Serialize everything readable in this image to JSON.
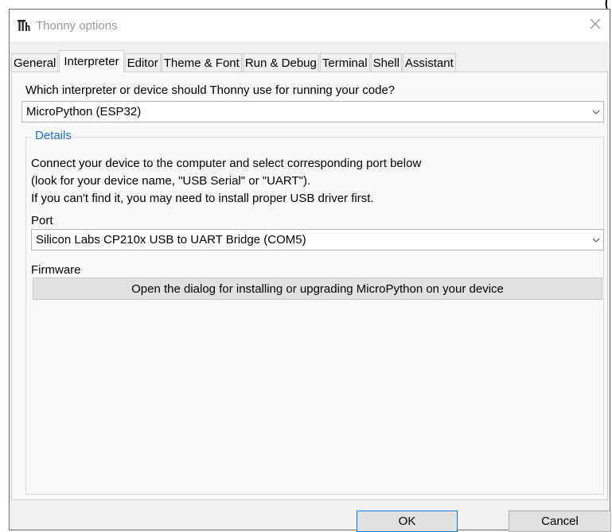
{
  "doc_fragment": "(",
  "window": {
    "title": "Thonny options",
    "close_glyph": "×"
  },
  "tabs": [
    {
      "label": "General",
      "selected": false
    },
    {
      "label": "Interpreter",
      "selected": true
    },
    {
      "label": "Editor",
      "selected": false
    },
    {
      "label": "Theme & Font",
      "selected": false
    },
    {
      "label": "Run & Debug",
      "selected": false
    },
    {
      "label": "Terminal",
      "selected": false
    },
    {
      "label": "Shell",
      "selected": false
    },
    {
      "label": "Assistant",
      "selected": false
    }
  ],
  "interpreter": {
    "question": "Which interpreter or device should Thonny use for running your code?",
    "selected": "MicroPython (ESP32)"
  },
  "details": {
    "legend": "Details",
    "lines": [
      "Connect your device to the computer and select corresponding port below",
      "(look for your device name, \"USB Serial\" or \"UART\").",
      "If you can't find it, you may need to install proper USB driver first."
    ],
    "port_label": "Port",
    "port_selected": "Silicon Labs CP210x USB to UART Bridge (COM5)",
    "firmware_label": "Firmware",
    "firmware_button": "Open the dialog for installing or upgrading MicroPython on your device"
  },
  "buttons": {
    "ok": "OK",
    "cancel": "Cancel"
  },
  "colors": {
    "legend_blue": "#1f6fd0",
    "ok_focus_border": "#0078d7"
  },
  "icons": {
    "app": "thonny-logo-icon",
    "close": "close-icon",
    "dropdown": "chevron-down-icon"
  }
}
